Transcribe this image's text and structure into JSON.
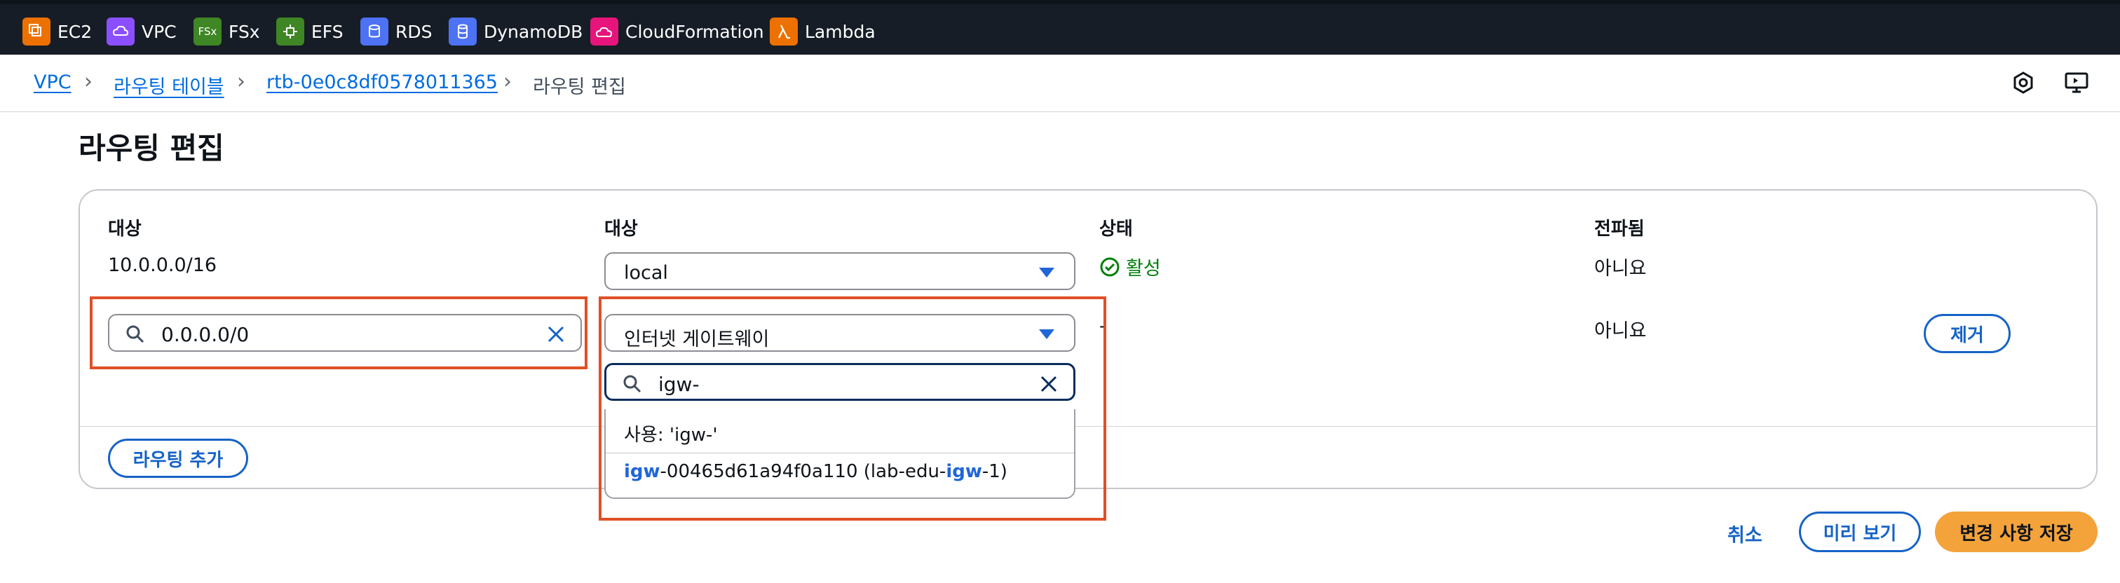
{
  "services": [
    {
      "label": "EC2",
      "icon": "ec2-icon",
      "color": "#ed7100"
    },
    {
      "label": "VPC",
      "icon": "vpc-icon",
      "color": "#8c4fff"
    },
    {
      "label": "FSx",
      "icon": "fsx-icon",
      "color": "#3f8624"
    },
    {
      "label": "EFS",
      "icon": "efs-icon",
      "color": "#3f8624"
    },
    {
      "label": "RDS",
      "icon": "rds-icon",
      "color": "#4d72f3"
    },
    {
      "label": "DynamoDB",
      "icon": "dynamodb-icon",
      "color": "#4d72f3"
    },
    {
      "label": "CloudFormation",
      "icon": "cloudformation-icon",
      "color": "#e7157b"
    },
    {
      "label": "Lambda",
      "icon": "lambda-icon",
      "color": "#ed7100"
    }
  ],
  "fsx_badge": "FSx",
  "breadcrumb": {
    "vpc": "VPC",
    "route_tables": "라우팅 테이블",
    "rtb_id": "rtb-0e0c8df0578011365",
    "current": "라우팅 편집"
  },
  "page_title": "라우팅 편집",
  "columns": {
    "destination": "대상",
    "target": "대상",
    "status": "상태",
    "propagated": "전파됨"
  },
  "rows": [
    {
      "destination": "10.0.0.0/16",
      "target": "local",
      "status": "활성",
      "propagated": "아니요"
    },
    {
      "destination": "0.0.0.0/0",
      "target": "인터넷 게이트웨이",
      "status": "-",
      "propagated": "아니요",
      "remove": "제거"
    }
  ],
  "target_search": {
    "value": "igw-"
  },
  "dropdown": {
    "use_option": "사용: 'igw-'",
    "option_prefix_hl": "igw",
    "option_mid": "-00465d61a94f0a110 (lab-edu-",
    "option_mid_hl": "igw",
    "option_suffix": "-1)"
  },
  "add_route": "라우팅 추가",
  "footer": {
    "cancel": "취소",
    "preview": "미리 보기",
    "save": "변경 사항 저장"
  },
  "colors": {
    "accent": "#1663c7",
    "primary_button": "#f4a23a",
    "highlight_box": "#e04f26",
    "status_active": "#037f0c"
  }
}
